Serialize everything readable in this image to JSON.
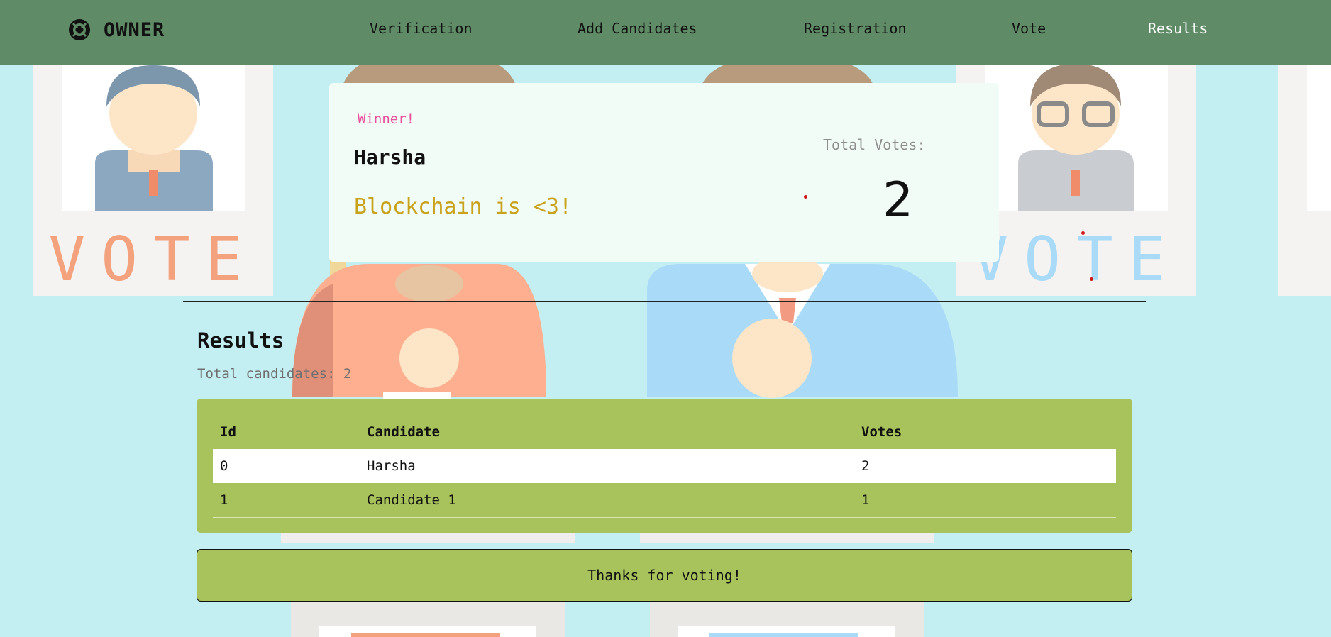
{
  "brand": {
    "name": "OWNER",
    "icon": "lifebuoy-icon"
  },
  "nav": {
    "items": [
      {
        "label": "Verification"
      },
      {
        "label": "Add Candidates"
      },
      {
        "label": "Registration"
      },
      {
        "label": "Vote"
      },
      {
        "label": "Results"
      }
    ],
    "active": "Results"
  },
  "background": {
    "poster_text": "VOTE"
  },
  "winner": {
    "tag": "Winner!",
    "name": "Harsha",
    "message": "Blockchain is <3!",
    "total_votes_label": "Total Votes:",
    "total_votes": "2"
  },
  "results": {
    "title": "Results",
    "subtitle": "Total candidates: 2",
    "columns": [
      "Id",
      "Candidate",
      "Votes"
    ],
    "rows": [
      {
        "id": "0",
        "candidate": "Harsha",
        "votes": "2"
      },
      {
        "id": "1",
        "candidate": "Candidate 1",
        "votes": "1"
      }
    ]
  },
  "thanks_label": "Thanks for voting!",
  "colors": {
    "background": "#c3eef2",
    "navbar": "#5f8c66",
    "card": "#f2fcf6",
    "table": "#a8c25c",
    "winner_tag": "#e94e9a",
    "winner_message": "#c8a21a"
  }
}
